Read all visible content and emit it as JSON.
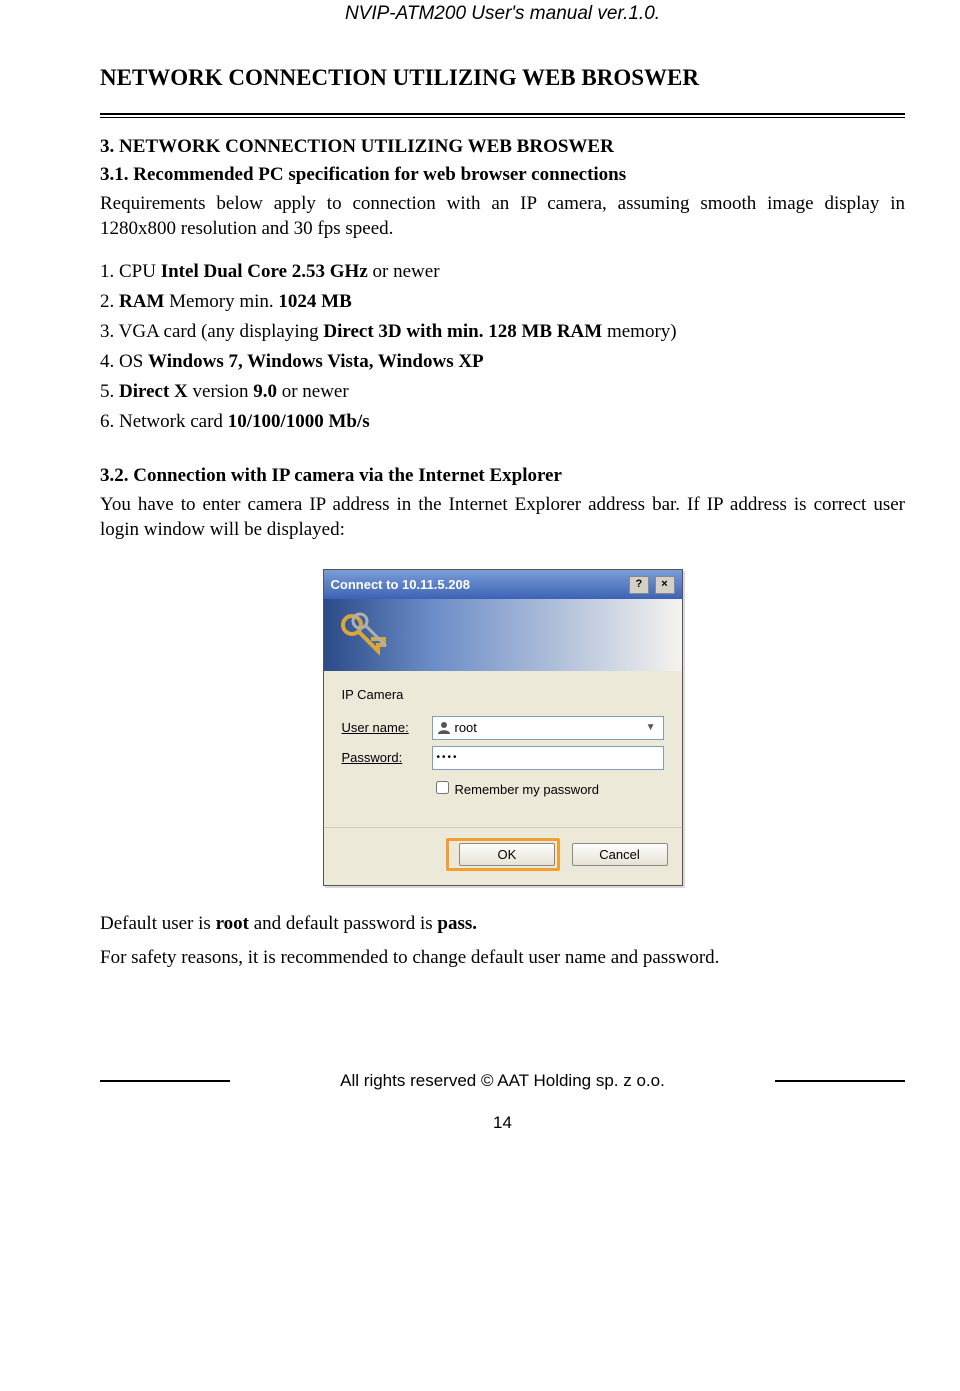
{
  "header": "NVIP-ATM200 User's manual ver.1.0.",
  "title": "NETWORK CONNECTION UTILIZING WEB BROSWER",
  "lang_tab": "eng",
  "sec3": "3. NETWORK CONNECTION UTILIZING WEB BROSWER",
  "sec31": "3.1. Recommended PC specification for web browser connections",
  "sec31_body": "Requirements below apply to connection with an IP camera, assuming smooth image display in 1280x800 resolution and 30 fps speed.",
  "req": {
    "i1a": "1. CPU ",
    "i1b": "Intel Dual Core 2.53 GHz",
    "i1c": " or newer",
    "i2a": "2. ",
    "i2b": "RAM",
    "i2c": " Memory min. ",
    "i2d": "1024 MB",
    "i3a": "3. VGA card (any displaying ",
    "i3b": "Direct 3D with min. 128 MB RAM",
    "i3c": " memory)",
    "i4a": "4. OS ",
    "i4b": "Windows 7, Windows Vista, Windows XP",
    "i5a": "5. ",
    "i5b": "Direct X",
    "i5c": " version ",
    "i5d": "9.0",
    "i5e": " or newer",
    "i6a": "6. Network card ",
    "i6b": "10/100/1000 Mb/s"
  },
  "sec32": "3.2. Connection with IP camera via the Internet Explorer",
  "sec32_body": "You have to enter camera IP address in the Internet Explorer address bar. If IP address is correct user login window will be displayed:",
  "dialog": {
    "title": "Connect to 10.11.5.208",
    "section": "IP Camera",
    "user_label": "User name:",
    "pass_label": "Password:",
    "user_value": "root",
    "pass_value": "••••",
    "remember": "Remember my password",
    "ok": "OK",
    "cancel": "Cancel"
  },
  "after1a": "Default user is ",
  "after1b": "root",
  "after1c": " and default password is ",
  "after1d": "pass.",
  "after2": "For safety reasons, it is recommended to change default user name and password.",
  "footer": "All rights reserved © AAT Holding sp. z o.o.",
  "pagenum": "14"
}
